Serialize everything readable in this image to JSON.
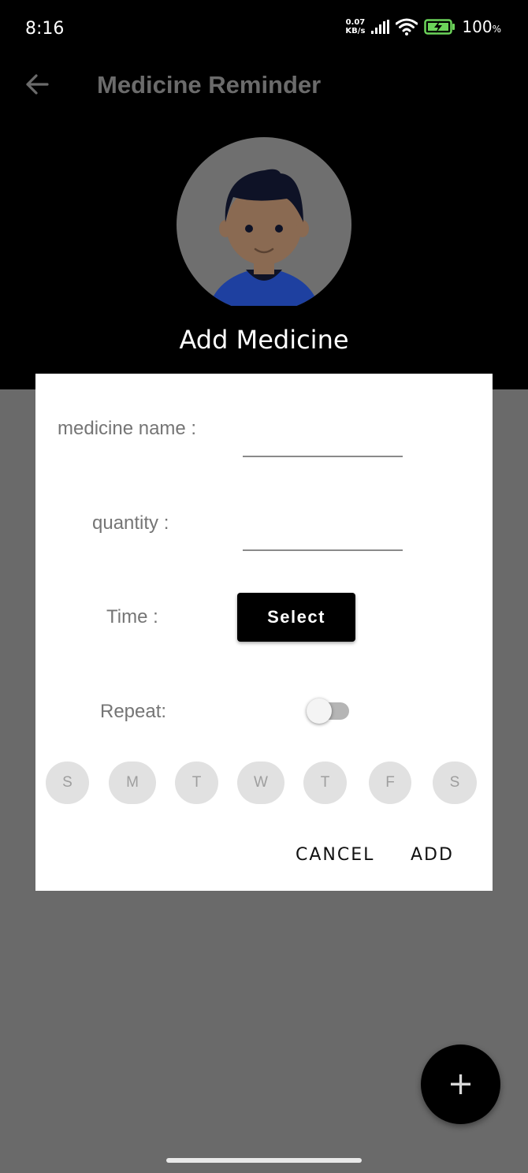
{
  "status_bar": {
    "time": "8:16",
    "net_speed_value": "0.07",
    "net_speed_unit": "KB/s",
    "battery_percent": "100",
    "battery_percent_sign": "%"
  },
  "toolbar": {
    "title": "Medicine Reminder"
  },
  "dialog": {
    "title": "Add Medicine",
    "medicine_name_label": "medicine name :",
    "medicine_name_value": "",
    "quantity_label": "quantity :",
    "quantity_value": "",
    "time_label": "Time :",
    "select_button_label": "Select",
    "repeat_label": "Repeat:",
    "repeat_enabled": false,
    "days": [
      {
        "label": "S"
      },
      {
        "label": "M"
      },
      {
        "label": "T"
      },
      {
        "label": "W"
      },
      {
        "label": "T"
      },
      {
        "label": "F"
      },
      {
        "label": "S"
      }
    ],
    "cancel_label": "CANCEL",
    "add_label": "ADD"
  },
  "fab": {
    "label": "+"
  },
  "colors": {
    "header_bg": "#000000",
    "backdrop": "#6a6a6a",
    "dialog_bg": "#ffffff",
    "chip_bg": "#e1e1e1",
    "avatar_shirt": "#1e40a0"
  }
}
